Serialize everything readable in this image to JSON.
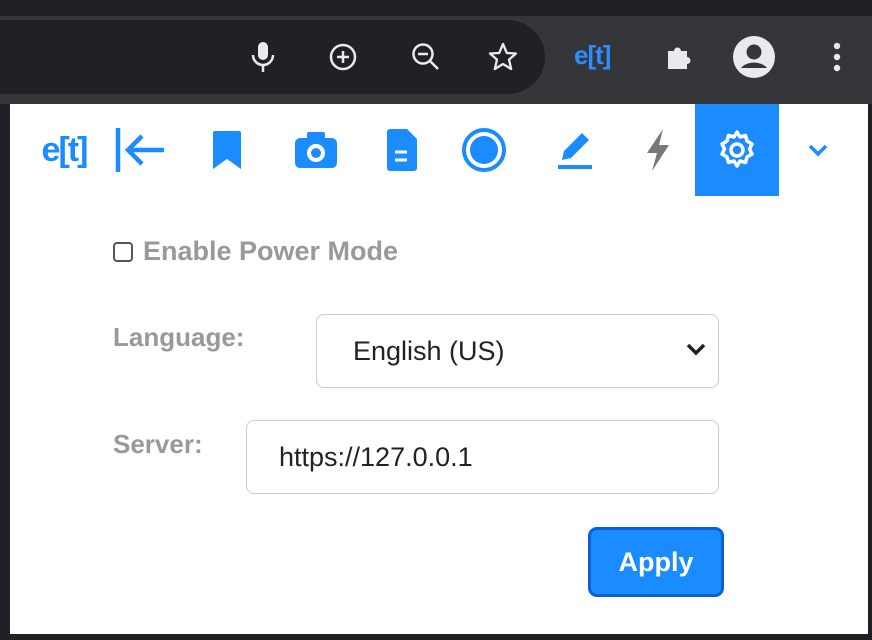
{
  "browser": {
    "icons": [
      "microphone-icon",
      "zoom-in-icon",
      "zoom-out-icon",
      "bookmark-star-icon",
      "extension-logo",
      "extensions-puzzle-icon",
      "profile-icon",
      "menu-icon"
    ],
    "extension_logo_text": "e[t]"
  },
  "popup": {
    "logo_text": "e[t]",
    "toolbar_icons": [
      "collapse-arrow-icon",
      "bookmark-icon",
      "camera-icon",
      "document-icon",
      "record-icon",
      "pencil-icon",
      "lightning-icon",
      "settings-gear-icon",
      "chevron-down-icon"
    ],
    "active_tool": "settings-gear-icon",
    "power_mode": {
      "label": "Enable Power Mode",
      "checked": false
    },
    "language": {
      "label": "Language:",
      "value": "English (US)"
    },
    "server": {
      "label": "Server:",
      "value": "https://127.0.0.1"
    },
    "apply_label": "Apply"
  },
  "colors": {
    "accent": "#1a8cff",
    "muted_label": "#999999",
    "browser_dark": "#202124",
    "browser_bar": "#35363a"
  }
}
